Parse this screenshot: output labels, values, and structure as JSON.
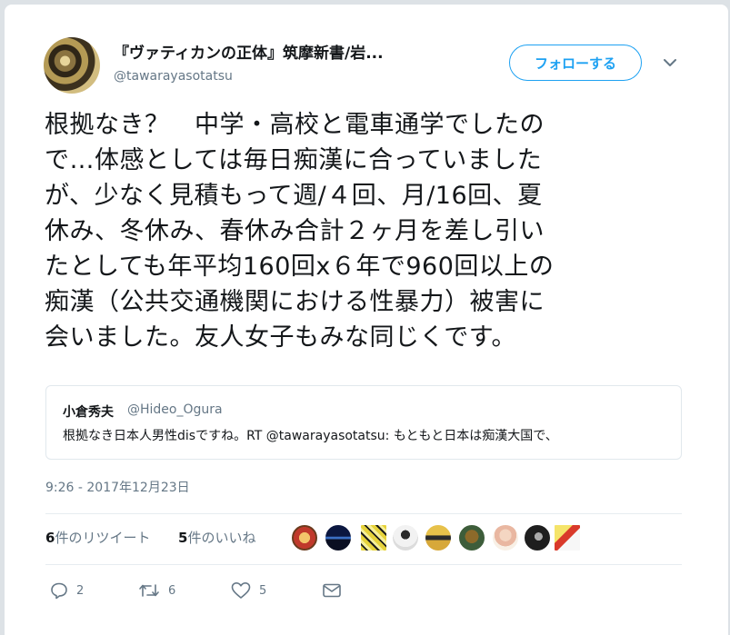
{
  "author": {
    "display_name": "『ヴァティカンの正体』筑摩新書/岩...",
    "handle": "@tawarayasotatsu"
  },
  "follow_button": {
    "label": "フォローする"
  },
  "tweet": {
    "lines": [
      "根拠なき？　中学・高校と電車通学でしたの",
      "で…体感としては毎日痴漢に合っていました",
      "が、少なく見積もって週/４回、月/16回、夏",
      "休み、冬休み、春休み合計２ヶ月を差し引い",
      "たとしても年平均160回x６年で960回以上の",
      "痴漢（公共交通機関における性暴力）被害に",
      "会いました。友人女子もみな同じくです。"
    ]
  },
  "quoted_tweet": {
    "name": "小倉秀夫",
    "handle": "@Hideo_Ogura",
    "text": "根拠なき日本人男性disですね。RT @tawarayasotatsu: もともと日本は痴漢大国で、"
  },
  "timestamp": "9:26 - 2017年12月23日",
  "stats": {
    "retweets_count": "6",
    "retweets_label": "件のリツイート",
    "likes_count": "5",
    "likes_label": "件のいいね"
  },
  "liker_avatars": [
    "liker-1",
    "liker-2",
    "liker-3",
    "liker-4",
    "liker-5",
    "liker-6",
    "liker-7",
    "liker-8",
    "liker-9"
  ],
  "actions": {
    "reply_count": "2",
    "retweet_count": "6",
    "like_count": "5"
  },
  "colors": {
    "accent": "#1da1f2",
    "muted": "#657786",
    "text": "#14171a"
  }
}
